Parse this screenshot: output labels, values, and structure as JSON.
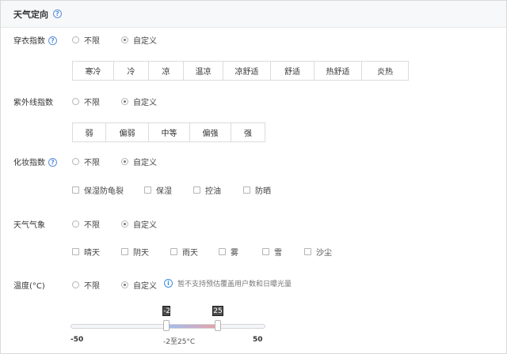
{
  "header": {
    "title": "天气定向",
    "help": "?"
  },
  "radio_options": {
    "unlimited": "不限",
    "custom": "自定义"
  },
  "dressing": {
    "label": "穿衣指数",
    "help": "?",
    "selected": "自定义",
    "levels": [
      "寒冷",
      "冷",
      "凉",
      "温凉",
      "凉舒适",
      "舒适",
      "热舒适",
      "炎热"
    ]
  },
  "uv": {
    "label": "紫外线指数",
    "selected": "自定义",
    "levels": [
      "弱",
      "偏弱",
      "中等",
      "偏强",
      "强"
    ]
  },
  "makeup": {
    "label": "化妆指数",
    "help": "?",
    "selected": "自定义",
    "options": [
      "保湿防龟裂",
      "保湿",
      "控油",
      "防晒"
    ]
  },
  "weather": {
    "label": "天气气象",
    "selected": "自定义",
    "options": [
      "晴天",
      "阴天",
      "雨天",
      "雾",
      "雪",
      "沙尘"
    ]
  },
  "temperature": {
    "label": "温度(°C)",
    "selected": "自定义",
    "note": "暂不支持预估覆盖用户数和日曝光量",
    "info_glyph": "i",
    "min": -50,
    "max": 50,
    "low": -2,
    "high": 25,
    "low_tag": "-2",
    "high_tag": "25",
    "min_label": "-50",
    "max_label": "50",
    "range_text": "-2至25°C"
  }
}
